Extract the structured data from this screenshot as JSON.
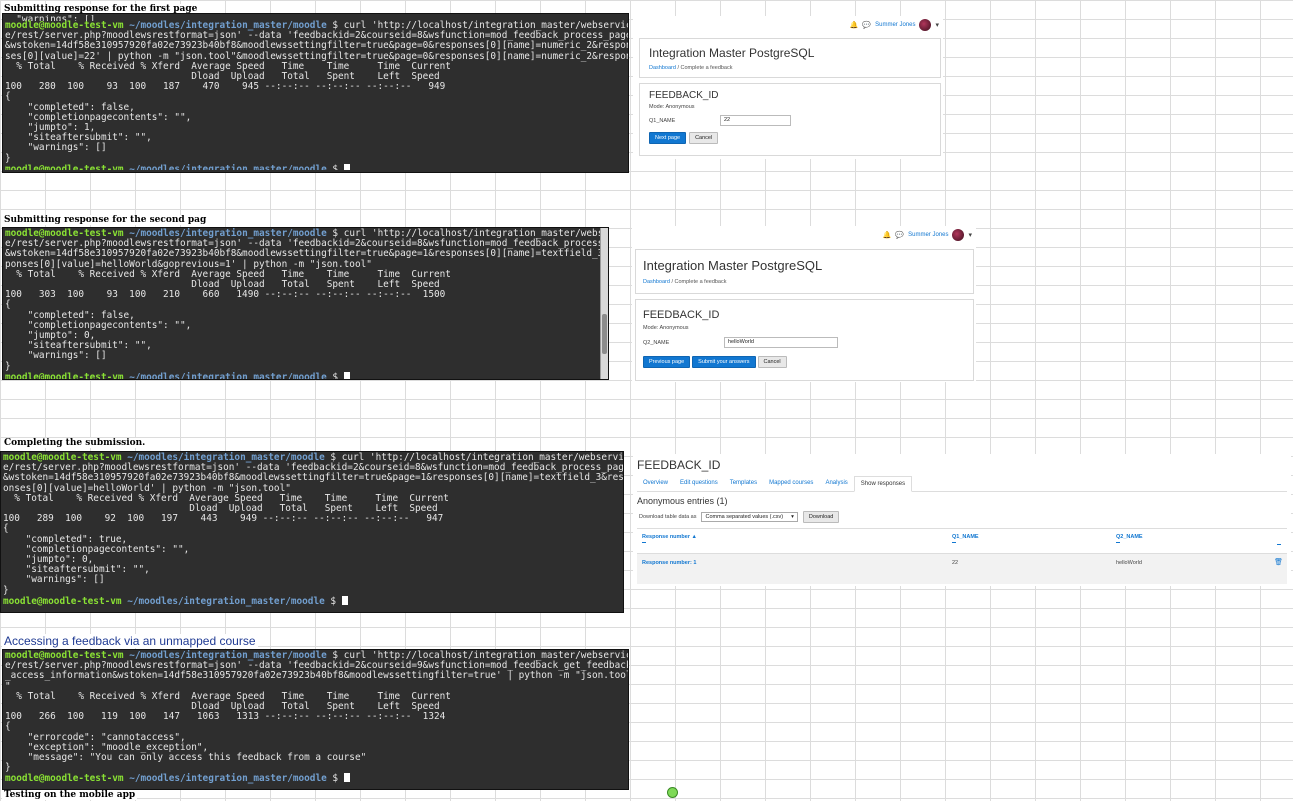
{
  "headings": {
    "first": "Submitting response for the first page",
    "second": "Submitting response for the second pag",
    "completing": "Completing the submission.",
    "unmapped": "Accessing a feedback via an unmapped course",
    "mobile": "Testing on the mobile app"
  },
  "prompt": {
    "user": "moodle@moodle-test-vm",
    "path": "~/moodles/integration_master/moodle",
    "symbol": "$"
  },
  "term1": {
    "top_fragment": "  \"warnings\": []",
    "command": [
      " curl 'http://localhost/integration_master/webservic",
      "e/rest/server.php?moodlewsrestformat=json' --data 'feedbackid=2&courseid=8&wsfunction=mod_feedback_process_page",
      "&wstoken=14df58e310957920fa02e73923b40bf8&moodlewssettingfilter=true&page=0&responses[0][name]=numeric_2&respon",
      "ses[0][value]=22' | python -m \"json.tool\"&moodlewssettingfilter=true&page=0&responses[0][name]=numeric_2&respon"
    ],
    "stats": [
      "  % Total    % Received % Xferd  Average Speed   Time    Time     Time  Current",
      "                                 Dload  Upload   Total   Spent    Left  Speed",
      "100   280  100    93  100   187    470    945 --:--:-- --:--:-- --:--:--   949"
    ],
    "json": [
      "{",
      "    \"completed\": false,",
      "    \"completionpagecontents\": \"\",",
      "    \"jumpto\": 1,",
      "    \"siteaftersubmit\": \"\",",
      "    \"warnings\": []",
      "}"
    ]
  },
  "term2": {
    "command": [
      " curl 'http://localhost/integration_master/webservic",
      "e/rest/server.php?moodlewsrestformat=json' --data 'feedbackid=2&courseid=8&wsfunction=mod_feedback_process_page",
      "&wstoken=14df58e310957920fa02e73923b40bf8&moodlewssettingfilter=true&page=1&responses[0][name]=textfield_3&res",
      "ponses[0][value]=helloWorld&goprevious=1' | python -m \"json.tool\""
    ],
    "stats": [
      "  % Total    % Received % Xferd  Average Speed   Time    Time     Time  Current",
      "                                 Dload  Upload   Total   Spent    Left  Speed",
      "100   303  100    93  100   210    660   1490 --:--:-- --:--:-- --:--:--  1500"
    ],
    "json": [
      "{",
      "    \"completed\": false,",
      "    \"completionpagecontents\": \"\",",
      "    \"jumpto\": 0,",
      "    \"siteaftersubmit\": \"\",",
      "    \"warnings\": []",
      "}"
    ]
  },
  "term3": {
    "command": [
      " curl 'http://localhost/integration_master/webservic",
      "e/rest/server.php?moodlewsrestformat=json' --data 'feedbackid=2&courseid=8&wsfunction=mod_feedback_process_page",
      "&wstoken=14df58e310957920fa02e73923b40bf8&moodlewssettingfilter=true&page=1&responses[0][name]=textfield_3&resp",
      "onses[0][value]=helloWorld' | python -m \"json.tool\""
    ],
    "stats": [
      "  % Total    % Received % Xferd  Average Speed   Time    Time     Time  Current",
      "                                 Dload  Upload   Total   Spent    Left  Speed",
      "100   289  100    92  100   197    443    949 --:--:-- --:--:-- --:--:--   947"
    ],
    "json": [
      "{",
      "    \"completed\": true,",
      "    \"completionpagecontents\": \"\",",
      "    \"jumpto\": 0,",
      "    \"siteaftersubmit\": \"\",",
      "    \"warnings\": []",
      "}"
    ]
  },
  "term4": {
    "command": [
      " curl 'http://localhost/integration_master/webservic",
      "e/rest/server.php?moodlewsrestformat=json' --data 'feedbackid=2&courseid=9&wsfunction=mod_feedback_get_feedback",
      "_access_information&wstoken=14df58e310957920fa02e73923b40bf8&moodlewssettingfilter=true' | python -m \"json.tool",
      "\""
    ],
    "stats": [
      "  % Total    % Received % Xferd  Average Speed   Time    Time     Time  Current",
      "                                 Dload  Upload   Total   Spent    Left  Speed",
      "100   266  100   119  100   147   1063   1313 --:--:-- --:--:-- --:--:--  1324"
    ],
    "json": [
      "{",
      "    \"errorcode\": \"cannotaccess\",",
      "    \"exception\": \"moodle_exception\",",
      "    \"message\": \"You can only access this feedback from a course\"",
      "}"
    ]
  },
  "moodle": {
    "user_name": "Summer Jones",
    "site_title": "Integration Master PostgreSQL",
    "breadcrumb_home": "Dashboard",
    "breadcrumb_sep": "/",
    "breadcrumb_current": "Complete a feedback",
    "feedback_title": "FEEDBACK_ID",
    "mode": "Mode: Anonymous"
  },
  "form1": {
    "label": "Q1_NAME",
    "value": "22",
    "next": "Next page",
    "cancel": "Cancel"
  },
  "form2": {
    "label": "Q2_NAME",
    "value": "helloWorld",
    "previous": "Previous page",
    "submit": "Submit your answers",
    "cancel": "Cancel"
  },
  "report": {
    "title": "FEEDBACK_ID",
    "tabs": [
      "Overview",
      "Edit questions",
      "Templates",
      "Mapped courses",
      "Analysis",
      "Show responses"
    ],
    "entries_heading": "Anonymous entries (1)",
    "download_label": "Download table data as",
    "download_format": "Comma separated values (.csv)",
    "download_button": "Download",
    "columns": [
      "Response number",
      "Q1_NAME",
      "Q2_NAME"
    ],
    "sort_arrow": "▲",
    "row": {
      "response": "Response number: 1",
      "q1": "22",
      "q2": "helloWorld"
    }
  },
  "colors": {
    "terminal_bg": "#2e2e2e",
    "prompt_green": "#8ae234",
    "path_blue": "#729fcf",
    "moodle_blue": "#1177d1"
  }
}
